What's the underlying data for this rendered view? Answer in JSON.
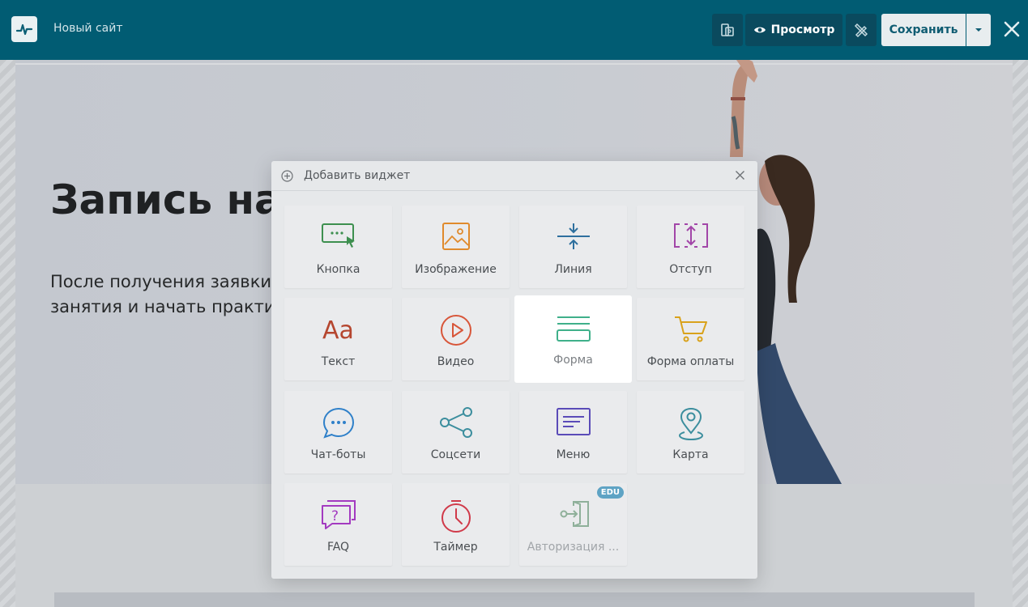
{
  "app": {
    "site_name": "Новый сайт"
  },
  "toolbar": {
    "preview_label": "Просмотр",
    "save_label": "Сохранить"
  },
  "page": {
    "hero_title": "Запись на",
    "hero_text_line1": "После получения заявки я",
    "hero_text_line2": "занятия и начать практику"
  },
  "modal": {
    "title": "Добавить виджет",
    "widgets": [
      {
        "label": "Кнопка",
        "icon": "button-icon",
        "color": "#3d8f4f"
      },
      {
        "label": "Изображение",
        "icon": "image-icon",
        "color": "#e08a2c"
      },
      {
        "label": "Линия",
        "icon": "line-icon",
        "color": "#2e6f9e"
      },
      {
        "label": "Отступ",
        "icon": "spacing-icon",
        "color": "#a246a8"
      },
      {
        "label": "Текст",
        "icon": "text-icon",
        "color": "#b5462f"
      },
      {
        "label": "Видео",
        "icon": "video-icon",
        "color": "#d8563a"
      },
      {
        "label": "Форма",
        "icon": "form-icon",
        "color": "#3fb08a"
      },
      {
        "label": "Форма оплаты",
        "icon": "cart-icon",
        "color": "#d9a21c"
      },
      {
        "label": "Чат-боты",
        "icon": "chat-icon",
        "color": "#2f80c9"
      },
      {
        "label": "Соцсети",
        "icon": "share-icon",
        "color": "#3c8e9e"
      },
      {
        "label": "Меню",
        "icon": "menu-icon",
        "color": "#5a4bb8"
      },
      {
        "label": "Карта",
        "icon": "map-pin-icon",
        "color": "#3c8e9e"
      },
      {
        "label": "FAQ",
        "icon": "faq-icon",
        "color": "#a33ac0"
      },
      {
        "label": "Таймер",
        "icon": "timer-icon",
        "color": "#d03a4a"
      },
      {
        "label": "Авторизация ...",
        "icon": "login-icon",
        "color": "#8fb09a",
        "badge": "EDU"
      }
    ]
  }
}
